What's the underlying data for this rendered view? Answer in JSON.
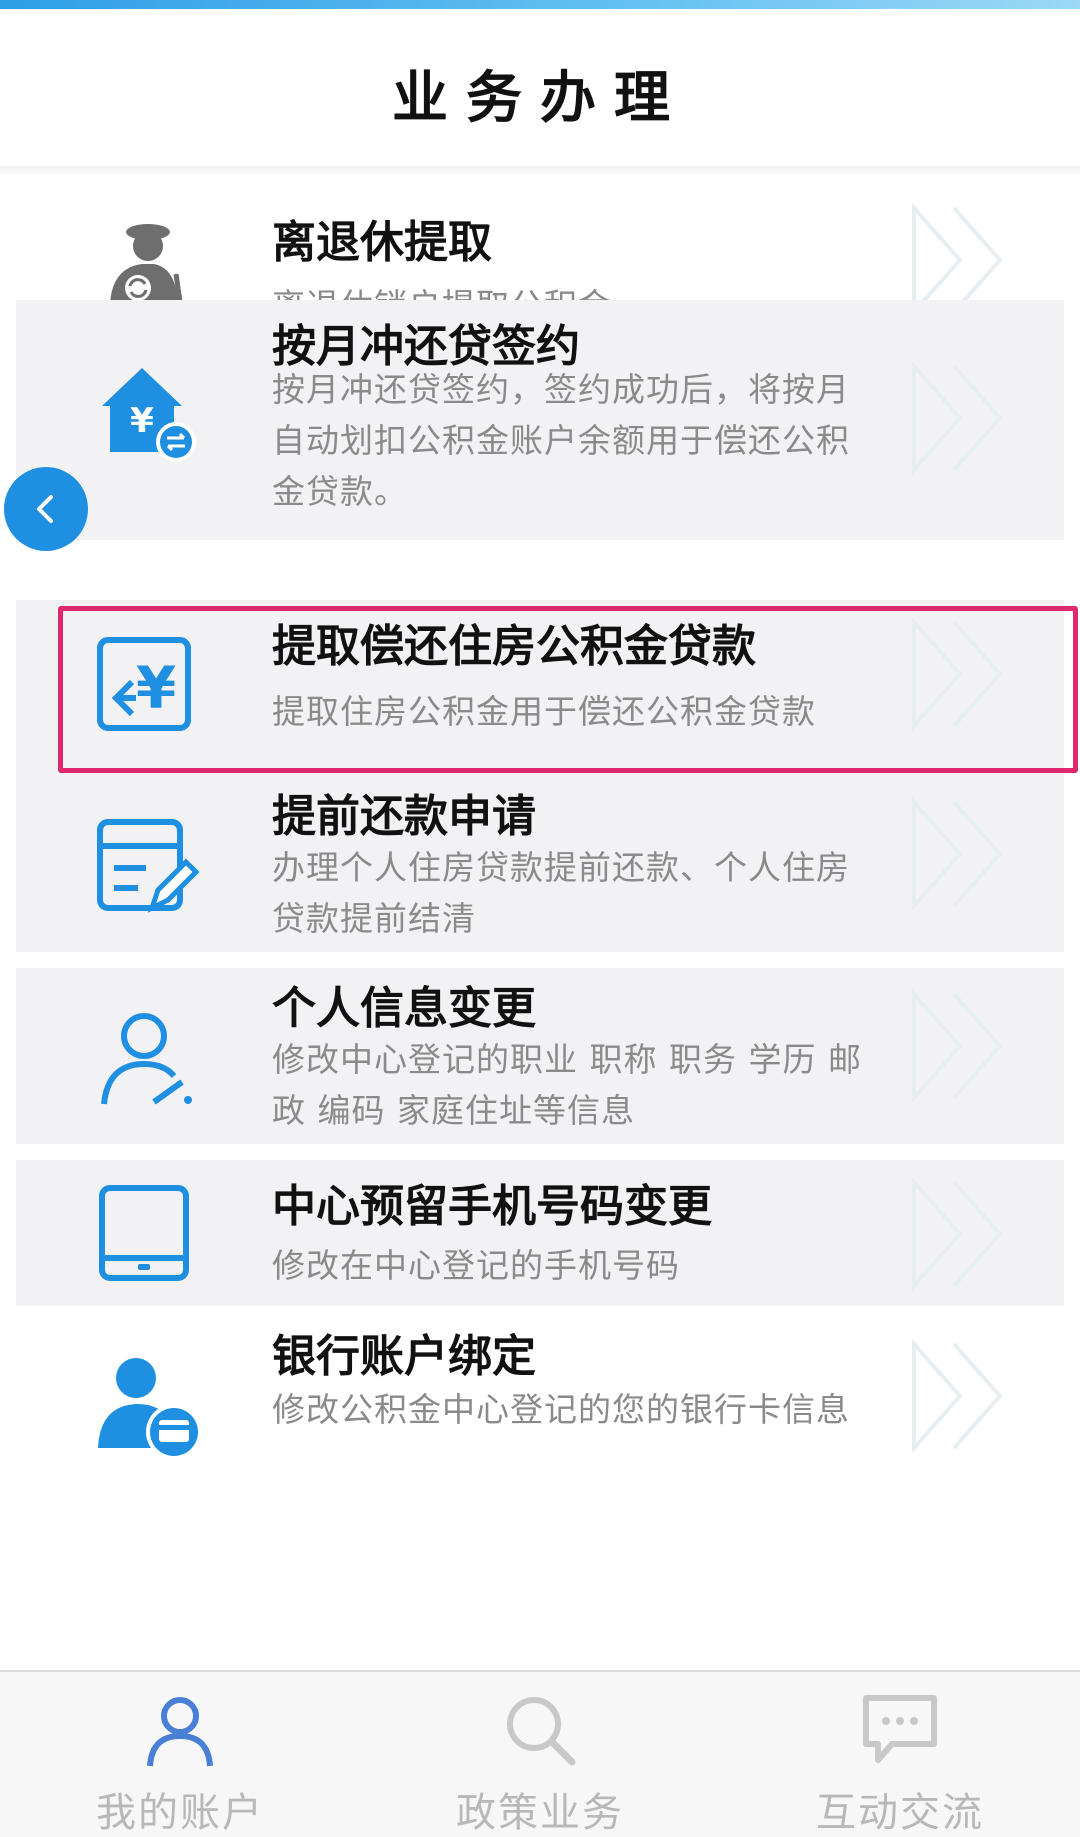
{
  "header": {
    "title": "业务办理"
  },
  "colors": {
    "accent": "#1e8fe1",
    "highlight_border": "#e0286e",
    "title_text": "#111111",
    "desc_text": "#8a8a8a",
    "tab_inactive": "#b8b8b8",
    "tab_active_icon": "#4a7fd6"
  },
  "services": [
    {
      "title": "离退休提取",
      "description": "离退休销户提取公积金",
      "icon": "retiree-icon"
    },
    {
      "title": "按月冲还贷签约",
      "description": "按月冲还贷签约，签约成功后，将按月自动划扣公积金账户余额用于偿还公积金贷款。",
      "icon": "house-yuan-icon"
    },
    {
      "title": "提取偿还住房公积金贷款",
      "description": "提取住房公积金用于偿还公积金贷款",
      "icon": "yuan-return-icon",
      "highlighted": true
    },
    {
      "title": "提前还款申请",
      "description": "办理个人住房贷款提前还款、个人住房贷款提前结清",
      "icon": "form-pencil-icon"
    },
    {
      "title": "个人信息变更",
      "description": "修改中心登记的职业 职称 职务 学历 邮政 编码 家庭住址等信息",
      "icon": "user-edit-icon"
    },
    {
      "title": "中心预留手机号码变更",
      "description": "修改在中心登记的手机号码",
      "icon": "tablet-icon"
    },
    {
      "title": "银行账户绑定",
      "description": "修改公积金中心登记的您的银行卡信息",
      "icon": "user-card-icon"
    }
  ],
  "back_button": {
    "icon": "chevron-left-icon"
  },
  "tabbar": {
    "tabs": [
      {
        "label": "我的账户",
        "icon": "user-icon",
        "active": true
      },
      {
        "label": "政策业务",
        "icon": "search-icon",
        "active": false
      },
      {
        "label": "互动交流",
        "icon": "chat-icon",
        "active": false
      }
    ]
  }
}
